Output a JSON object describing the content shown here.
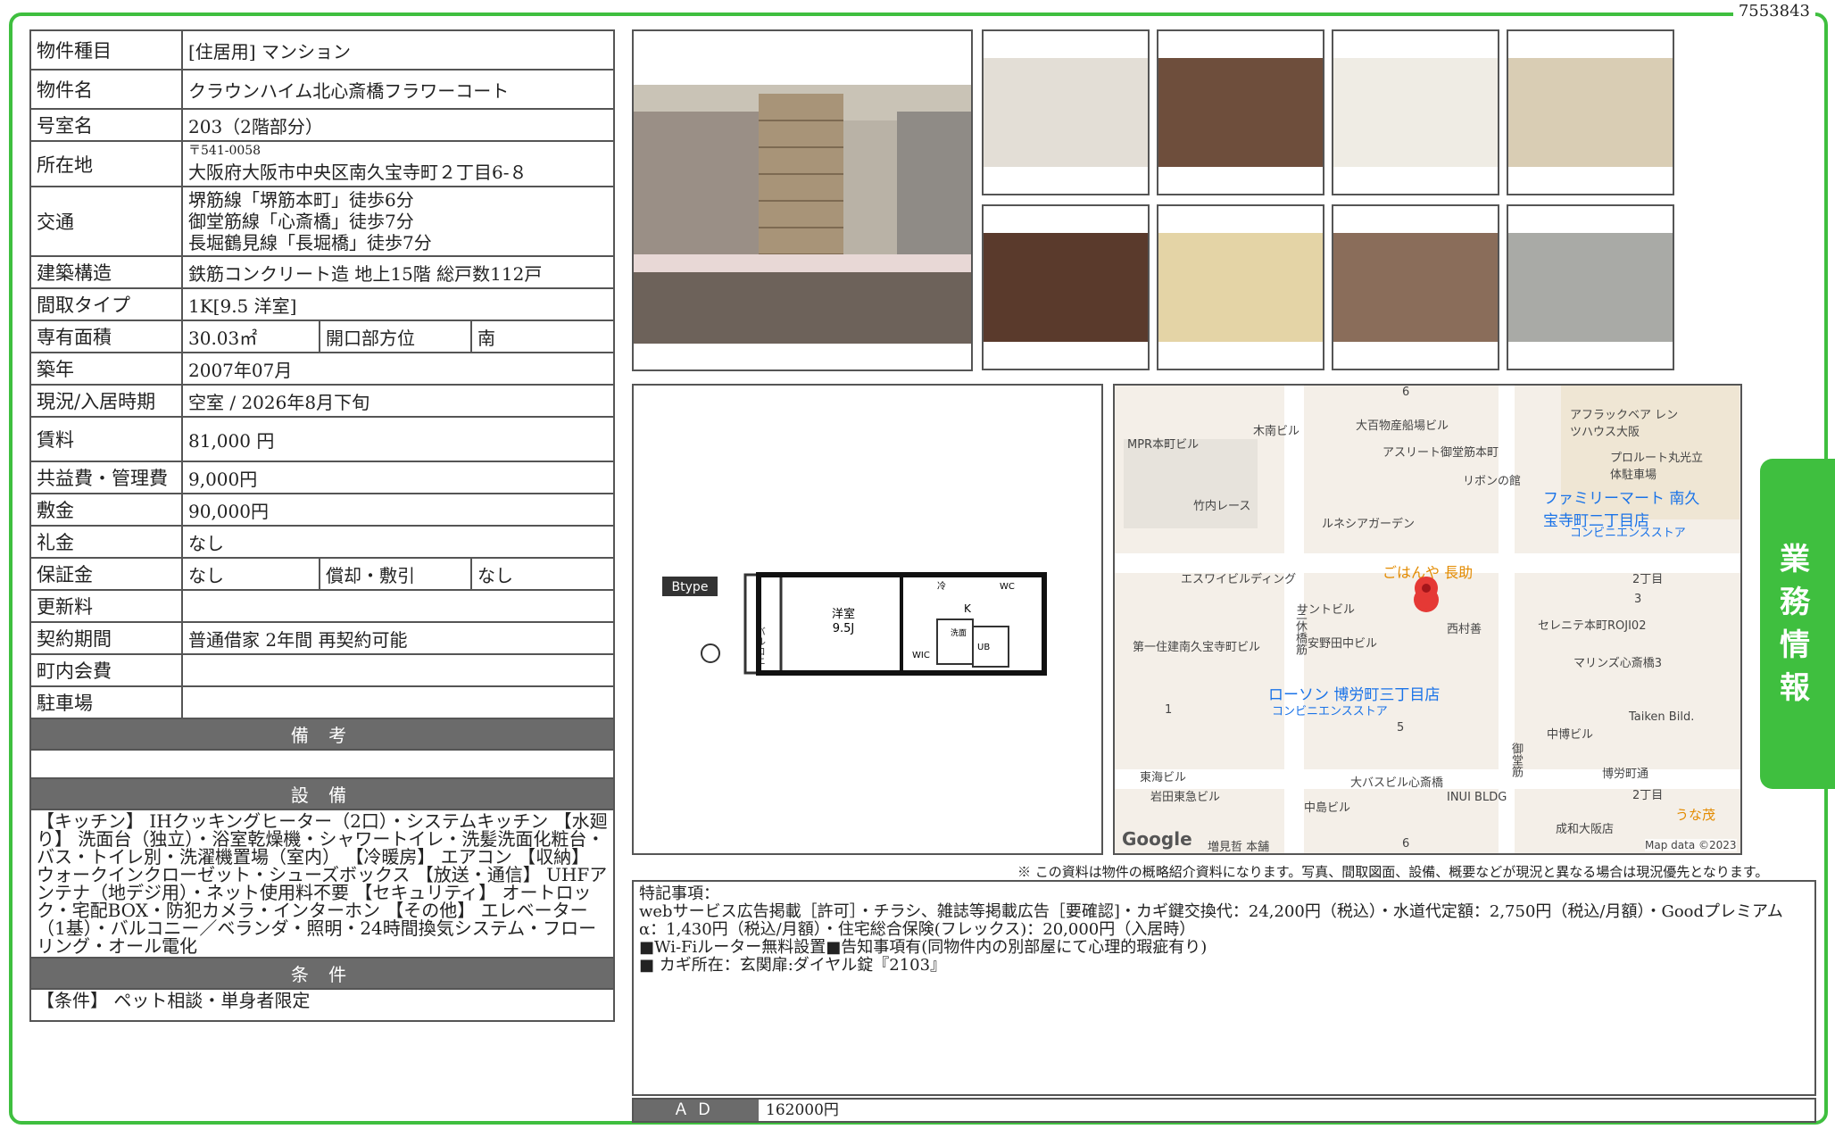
{
  "doc_id": "7553843",
  "side_tab": [
    "業",
    "務",
    "情",
    "報"
  ],
  "rows": {
    "type": {
      "label": "物件種目",
      "value": "[住居用]  マンション"
    },
    "name": {
      "label": "物件名",
      "value": "クラウンハイム北心斎橋フラワーコート"
    },
    "room": {
      "label": "号室名",
      "value": "203（2階部分）"
    },
    "address": {
      "label": "所在地",
      "zip": "〒541-0058",
      "value": "大阪府大阪市中央区南久宝寺町２丁目6-８"
    },
    "access": {
      "label": "交通",
      "lines": [
        "堺筋線「堺筋本町」徒歩6分",
        "御堂筋線「心斎橋」徒歩7分",
        "長堀鶴見線「長堀橋」徒歩7分"
      ]
    },
    "structure": {
      "label": "建築構造",
      "value": "鉄筋コンクリート造  地上15階  総戸数112戸"
    },
    "layout": {
      "label": "間取タイプ",
      "value": "1K[9.5 洋室]"
    },
    "area": {
      "label": "専有面積",
      "value": "30.03㎡",
      "label2": "開口部方位",
      "value2": "南"
    },
    "built": {
      "label": "築年",
      "value": "2007年07月"
    },
    "status": {
      "label": "現況/入居時期",
      "value": "空室  /  2026年8月下旬"
    },
    "rent": {
      "label": "賃料",
      "value": "81,000 円"
    },
    "fee": {
      "label": "共益費・管理費",
      "value": "9,000円"
    },
    "deposit": {
      "label": "敷金",
      "value": "90,000円"
    },
    "key_money": {
      "label": "礼金",
      "value": "なし"
    },
    "guarantee": {
      "label": "保証金",
      "value": "なし",
      "label2": "償却・敷引",
      "value2": "なし"
    },
    "renewal": {
      "label": "更新料",
      "value": ""
    },
    "contract": {
      "label": "契約期間",
      "value": "普通借家  2年間  再契約可能"
    },
    "town_fee": {
      "label": "町内会費",
      "value": ""
    },
    "parking": {
      "label": "駐車場",
      "value": ""
    }
  },
  "remarks_header": "備 考",
  "remarks_value": "",
  "equipment_header": "設 備",
  "equipment_text": "【キッチン】 IHクッキングヒーター（2口）・システムキッチン 【水廻り】 洗面台（独立）・浴室乾燥機・シャワートイレ・洗髪洗面化粧台・バス・トイレ別・洗濯機置場（室内） 【冷暖房】 エアコン 【収納】 ウォークインクローゼット・シューズボックス 【放送・通信】 UHFアンテナ（地デジ用）・ネット使用料不要 【セキュリティ】 オートロック・宅配BOX・防犯カメラ・インターホン 【その他】 エレベーター（1基）・バルコニー／ベランダ・照明・24時間換気システム・フローリング・オール電化",
  "conditions_header": "条 件",
  "conditions_text": "【条件】 ペット相談・単身者限定",
  "floorplan": {
    "btype": "Btype",
    "balcony": "バルコニー",
    "room": "洋室",
    "room_size": "9.5J",
    "k": "K",
    "wc": "WC",
    "ub": "UB",
    "wash": "洗面",
    "wic": "WIC",
    "fridge": "冷"
  },
  "map": {
    "labels": [
      "MPR本町ビル",
      "木南ビル",
      "大百物産船場ビル",
      "アスリート御堂筋本町",
      "リボンの館",
      "アフラックベア レンツハウス大阪",
      "プロルート丸光立体駐車場",
      "竹内レース",
      "ルネシアガーデン",
      "ファミリーマート 南久宝寺町二丁目店",
      "コンビニエンスストア",
      "ごはんや 長助",
      "エスワイビルディング",
      "サントビル",
      "西村善",
      "2丁目",
      "3",
      "セレニテ本町ROJI02",
      "第一住建南久宝寺町ビル",
      "安野田中ビル",
      "マリンズ心斎橋3",
      "ローソン 博労町三丁目店",
      "コンビニエンスストア",
      "1",
      "5",
      "中博ビル",
      "Taiken Bild.",
      "東海ビル",
      "岩田東急ビル",
      "大バスビル心斎橋",
      "INUI BLDG",
      "博労町通",
      "2丁目",
      "中島ビル",
      "成和大阪店",
      "うな茂",
      "増見哲 本舗",
      "6",
      "6",
      "三休橋筋",
      "御堂筋"
    ],
    "google": "Google",
    "mapdata": "Map data ©2023"
  },
  "notice": "※ この資料は物件の概略紹介資料になります。写真、間取図面、設備、概要などが現況と異なる場合は現況優先となります。",
  "special_notes": {
    "title": "特記事項：",
    "lines": [
      "webサービス広告掲載［許可］・チラシ、雑誌等掲載広告［要確認]・カギ鍵交換代：24,200円（税込）・水道代定額：2,750円（税込/月額）・Goodプレミアムα：1,430円（税込/月額）・住宅総合保険(フレックス)：20,000円（入居時）",
      "■Wi-Fiルーター無料設置■告知事項有(同物件内の別部屋にて心理的瑕疵有り)",
      "■ カギ所在：玄関扉:ダイヤル錠『2103』"
    ]
  },
  "ad": {
    "label": "ＡＤ",
    "value": "162000円"
  },
  "colors": {
    "green": "#3fbf3f",
    "gray": "#6b6b6b"
  }
}
